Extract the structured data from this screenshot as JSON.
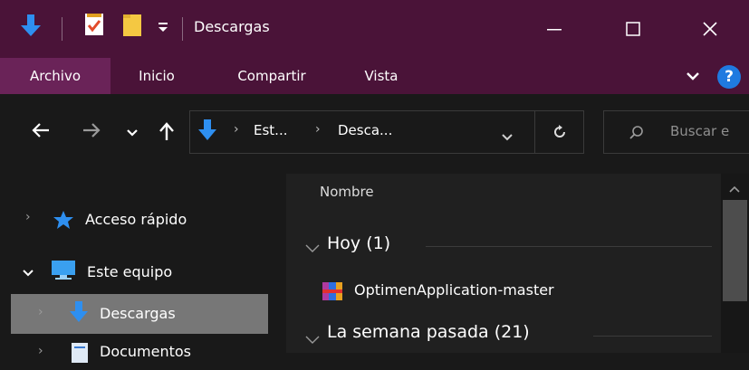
{
  "window": {
    "title": "Descargas",
    "accent": "#4a1338"
  },
  "quick_access": {
    "download_icon": "download-arrow-icon",
    "properties_icon": "properties-check-icon",
    "folder_icon": "new-folder-icon",
    "customize_icon": "customize-dropdown-icon"
  },
  "ribbon": {
    "tabs": [
      "Archivo",
      "Inicio",
      "Compartir",
      "Vista"
    ],
    "help_label": "?"
  },
  "address": {
    "crumbs": [
      "Est...",
      "Desca..."
    ]
  },
  "search": {
    "placeholder": "Buscar e"
  },
  "nav": {
    "items": [
      {
        "label": "Acceso rápido"
      },
      {
        "label": "Este equipo"
      },
      {
        "label": "Descargas"
      },
      {
        "label": "Documentos"
      }
    ]
  },
  "content": {
    "column_header": "Nombre",
    "groups": [
      {
        "label": "Hoy (1)"
      },
      {
        "label": "La semana pasada (21)"
      }
    ],
    "files": [
      {
        "name": "OptimenApplication-master"
      }
    ]
  }
}
